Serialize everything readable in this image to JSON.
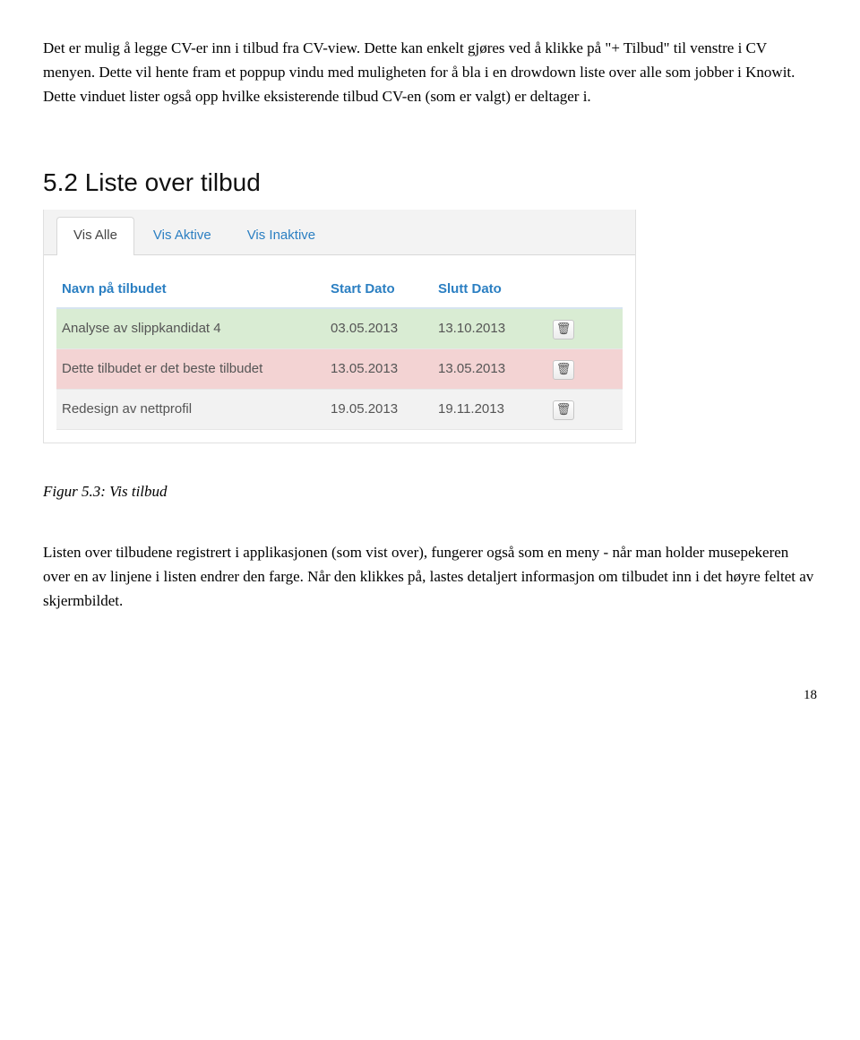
{
  "para1": "Det er mulig å legge CV-er inn i tilbud fra CV-view. Dette kan enkelt gjøres ved å klikke på \"+ Tilbud\" til venstre i CV menyen. Dette vil hente fram et poppup vindu med muligheten for å bla i en drowdown liste over alle som jobber i Knowit. Dette vinduet lister også opp hvilke eksisterende tilbud CV-en (som er valgt) er deltager i.",
  "section_heading": "5.2 Liste over tilbud",
  "tabs": {
    "vis_alle": "Vis Alle",
    "vis_aktive": "Vis Aktive",
    "vis_inaktive": "Vis Inaktive"
  },
  "table": {
    "headers": {
      "name": "Navn på tilbudet",
      "start": "Start Dato",
      "end": "Slutt Dato"
    },
    "rows": [
      {
        "name": "Analyse av slippkandidat 4",
        "start": "03.05.2013",
        "end": "13.10.2013"
      },
      {
        "name": "Dette tilbudet er det beste tilbudet",
        "start": "13.05.2013",
        "end": "13.05.2013"
      },
      {
        "name": "Redesign av nettprofil",
        "start": "19.05.2013",
        "end": "19.11.2013"
      }
    ]
  },
  "caption": "Figur 5.3: Vis tilbud",
  "para2": "Listen over tilbudene registrert i applikasjonen (som vist over), fungerer også som en meny - når man holder musepekeren over en av linjene i listen endrer den farge. Når den klikkes på, lastes detaljert informasjon om tilbudet inn i det høyre feltet av skjermbildet.",
  "page_number": "18",
  "icons": {
    "trash": "🗑"
  }
}
